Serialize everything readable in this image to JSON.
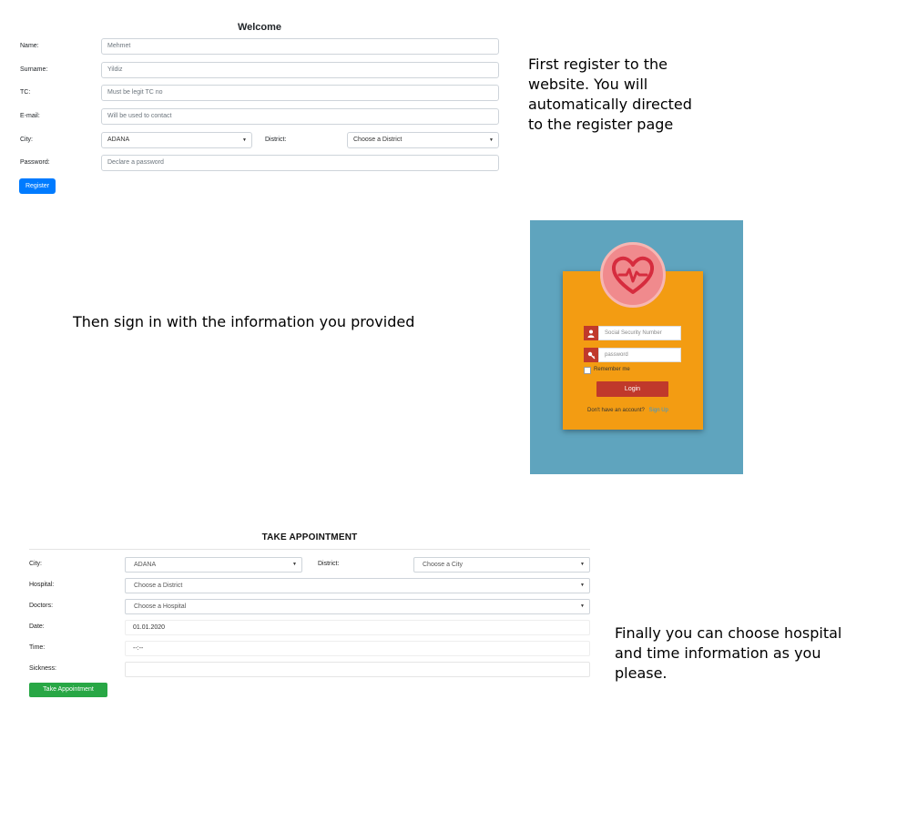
{
  "register": {
    "title": "Welcome",
    "labels": {
      "name": "Name:",
      "surname": "Surname:",
      "tc": "TC:",
      "email": "E-mail:",
      "city": "City:",
      "district": "District:",
      "password": "Password:"
    },
    "placeholders": {
      "name": "Mehmet",
      "surname": "Yildiz",
      "tc": "Must be legit TC no",
      "email": "Will be used to contact",
      "password": "Declare a password"
    },
    "city_value": "ADANA",
    "district_value": "Choose a District",
    "button": "Register"
  },
  "notes": {
    "first": [
      "First register to the",
      "website. You will",
      "automatically directed",
      "to the register page"
    ],
    "second": "Then sign in with the information you provided",
    "third": [
      "Finally you can choose hospital",
      "and time information as you",
      "please."
    ]
  },
  "login": {
    "ssn_placeholder": "Social Security Number",
    "password_placeholder": "password",
    "remember": "Remember me",
    "button": "Login",
    "no_account": "Don't have an account?",
    "signup": "Sign Up",
    "colors": {
      "background": "#5fa4be",
      "card": "#f39c12",
      "accent": "#c0392b",
      "link": "#3498db"
    },
    "icons": [
      "heart-pulse-icon",
      "user-icon",
      "key-icon"
    ]
  },
  "appointment": {
    "title": "TAKE APPOINTMENT",
    "labels": {
      "city": "City:",
      "district": "District:",
      "hospital": "Hospital:",
      "doctors": "Doctors:",
      "date": "Date:",
      "time": "Time:",
      "sickness": "Sickness:"
    },
    "city_value": "ADANA",
    "district_value": "Choose a City",
    "hospital_value": "Choose a District",
    "doctors_value": "Choose a Hospital",
    "date_value": "01.01.2020",
    "time_value": "--:--",
    "button": "Take Appointment"
  }
}
